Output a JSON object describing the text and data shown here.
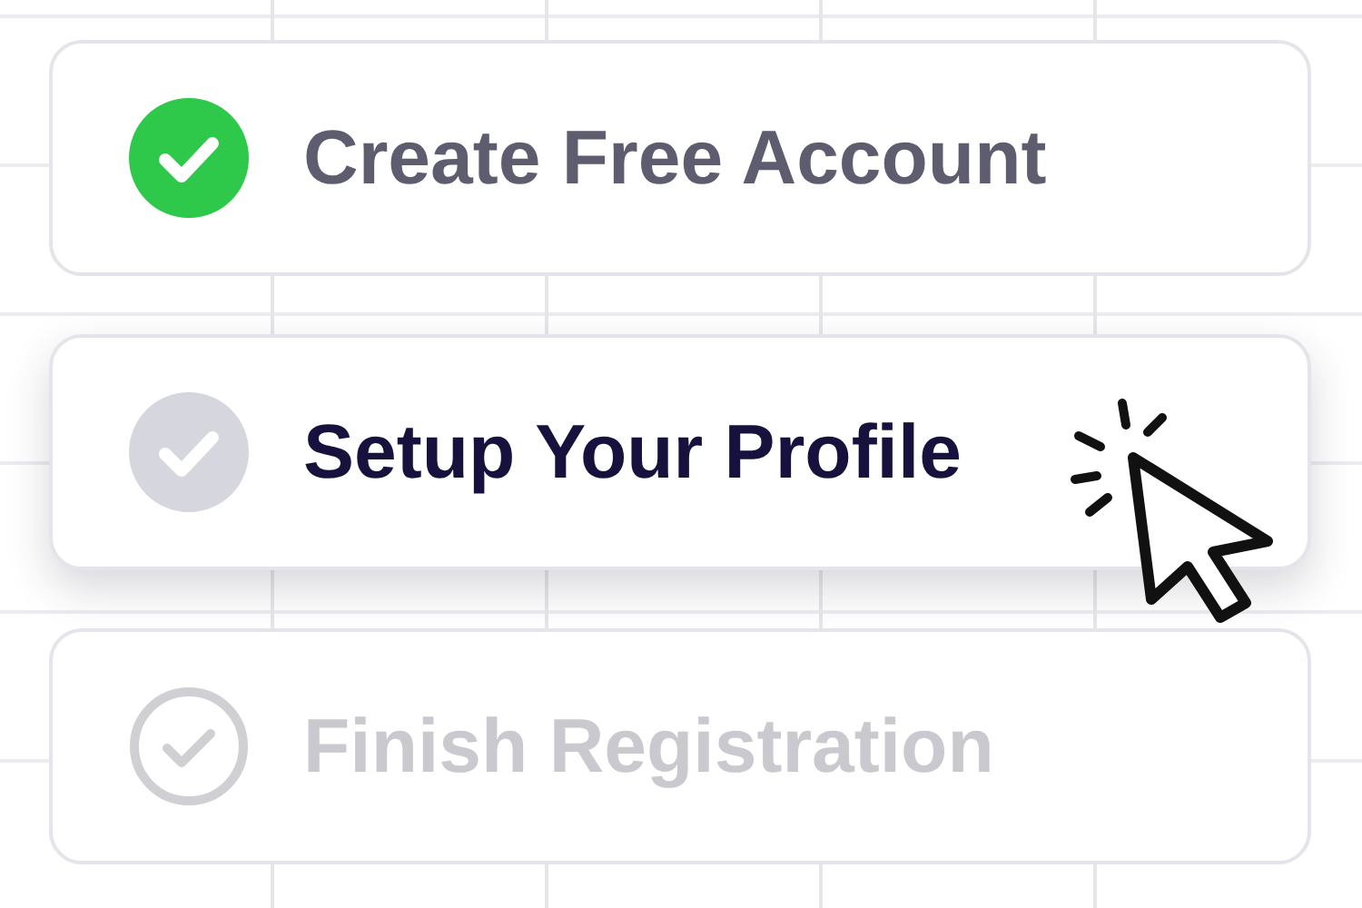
{
  "steps": [
    {
      "label": "Create Free Account",
      "kind": "done"
    },
    {
      "label": "Setup Your Profile",
      "kind": "current"
    },
    {
      "label": "Finish Registration",
      "kind": "pending"
    }
  ],
  "cursor": {
    "clicking": true
  }
}
